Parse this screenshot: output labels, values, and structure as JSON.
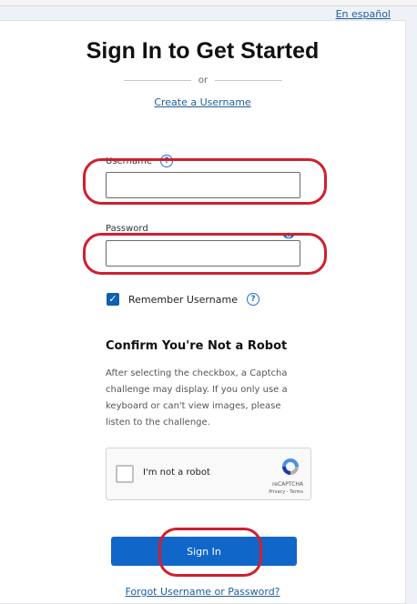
{
  "header": {
    "language_link": "En español"
  },
  "form": {
    "title": "Sign In to Get Started",
    "or_text": "or",
    "create_username_link": "Create a Username",
    "username_label": "Username",
    "username_value": "",
    "password_label": "Password",
    "password_value": "",
    "remember_label": "Remember Username",
    "remember_checked": true
  },
  "robot": {
    "title": "Confirm You're Not a Robot",
    "instructions": "After selecting the checkbox, a Captcha challenge may display. If you only use a keyboard or can't view images, please listen to the challenge.",
    "checkbox_label": "I'm not a robot",
    "brand": "reCAPTCHA",
    "terms": "Privacy - Terms"
  },
  "actions": {
    "sign_in_label": "Sign In",
    "forgot_link": "Forgot Username or Password?"
  },
  "colors": {
    "annotation": "#cf2030",
    "primary_button": "#1166c9",
    "link": "#1f5e9c"
  }
}
